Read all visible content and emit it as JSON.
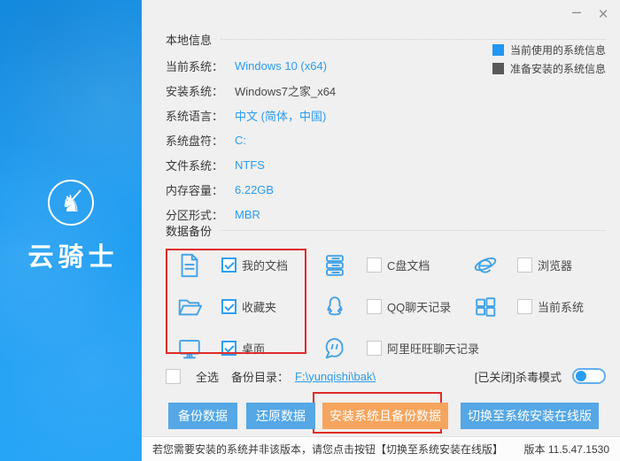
{
  "window": {
    "minimize_label": "–",
    "close_label": "×"
  },
  "sidebar": {
    "brand": "云骑士"
  },
  "local_info": {
    "title": "本地信息",
    "rows": [
      {
        "label": "当前系统：",
        "value": "Windows 10 (x64)"
      },
      {
        "label": "安装系统：",
        "value": "Windows7之家_x64"
      },
      {
        "label": "系统语言：",
        "value": "中文 (简体，中国)"
      },
      {
        "label": "系统盘符：",
        "value": "C:"
      },
      {
        "label": "文件系统：",
        "value": "NTFS"
      },
      {
        "label": "内存容量：",
        "value": "6.22GB"
      },
      {
        "label": "分区形式：",
        "value": "MBR"
      }
    ],
    "legend": [
      {
        "color": "#2196f3",
        "label": "当前使用的系统信息"
      },
      {
        "color": "#58595b",
        "label": "准备安装的系统信息"
      }
    ]
  },
  "backup": {
    "title": "数据备份",
    "items": [
      {
        "icon": "document-icon",
        "label": "我的文档",
        "checked": true
      },
      {
        "icon": "folder-icon",
        "label": "收藏夹",
        "checked": true
      },
      {
        "icon": "desktop-icon",
        "label": "桌面",
        "checked": true
      },
      {
        "icon": "drive-stack-icon",
        "label": "C盘文档",
        "checked": false
      },
      {
        "icon": "qq-icon",
        "label": "QQ聊天记录",
        "checked": false
      },
      {
        "icon": "wangwang-icon",
        "label": "阿里旺旺聊天记录",
        "checked": false
      },
      {
        "icon": "ie-browser-icon",
        "label": "浏览器",
        "checked": false
      },
      {
        "icon": "windows-icon",
        "label": "当前系统",
        "checked": false
      }
    ],
    "select_all_label": "全选",
    "select_all_checked": false,
    "backup_dir_label": "备份目录：",
    "backup_dir_value": "F:\\yunqishi\\bak\\",
    "antivirus_label": "[已关闭]杀毒模式",
    "antivirus_on": false
  },
  "actions": {
    "backup": "备份数据",
    "restore": "还原数据",
    "install_backup": "安装系统且备份数据",
    "switch_online": "切换至系统安装在线版"
  },
  "footer": {
    "hint": "若您需要安装的系统并非该版本，请您点击按钮【切换至系统安装在线版】",
    "version": "版本 11.5.47.1530"
  },
  "colors": {
    "accent_blue": "#2b9cf0",
    "button_blue": "#55a7e6",
    "button_orange": "#f6a55e",
    "highlight_red": "#e02b2b"
  }
}
